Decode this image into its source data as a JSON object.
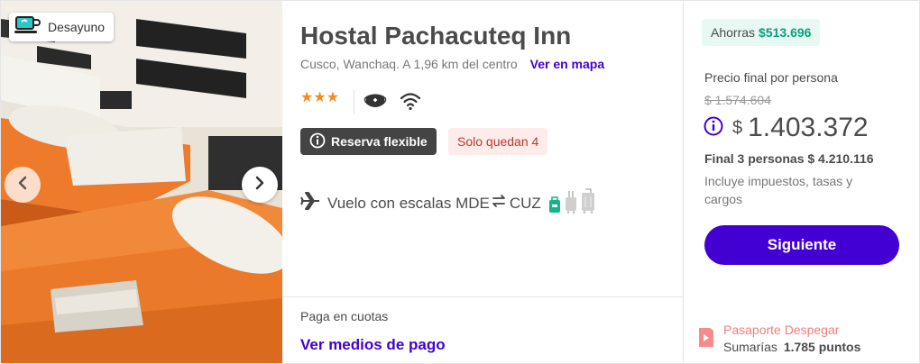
{
  "image": {
    "badge_label": "Desayuno",
    "badge_icon": "coffee-cup-icon",
    "prev_icon": "chevron-left-icon",
    "next_icon": "chevron-right-icon"
  },
  "hotel": {
    "name": "Hostal Pachacuteq Inn",
    "address": "Cusco, Wanchaq. A 1,96 km del centro",
    "map_link": "Ver en mapa",
    "stars": "★★★",
    "star_count": 3,
    "amenities": [
      "mask-icon",
      "wifi-icon"
    ],
    "flexible_label": "Reserva flexible",
    "availability": "Solo quedan 4",
    "flight": {
      "label": "Vuelo con escalas MDE",
      "destination": "CUZ",
      "icons": [
        "airplane-icon",
        "round-trip-arrows-icon",
        "personal-bag-icon",
        "carry-on-icon",
        "checked-bag-icon"
      ]
    },
    "installments_label": "Paga en cuotas",
    "installments_link": "Ver medios de pago"
  },
  "pricing": {
    "savings_label": "Ahorras",
    "savings_amount": "$513.696",
    "final_label": "Precio final por persona",
    "old_price": "$ 1.574.604",
    "currency": "$",
    "price": "1.403.372",
    "total": "Final 3 personas $ 4.210.116",
    "includes": "Incluye impuestos, tasas y cargos",
    "cta": "Siguiente",
    "loyalty_title": "Pasaporte Despegar",
    "loyalty_prefix": "Sumarías",
    "loyalty_points": "1.785 puntos"
  },
  "colors": {
    "brand": "#4300d2",
    "stars": "#f58a1f",
    "savings": "#0c9f7b",
    "warning_text": "#c0392b",
    "loyalty": "#f07e7e"
  }
}
